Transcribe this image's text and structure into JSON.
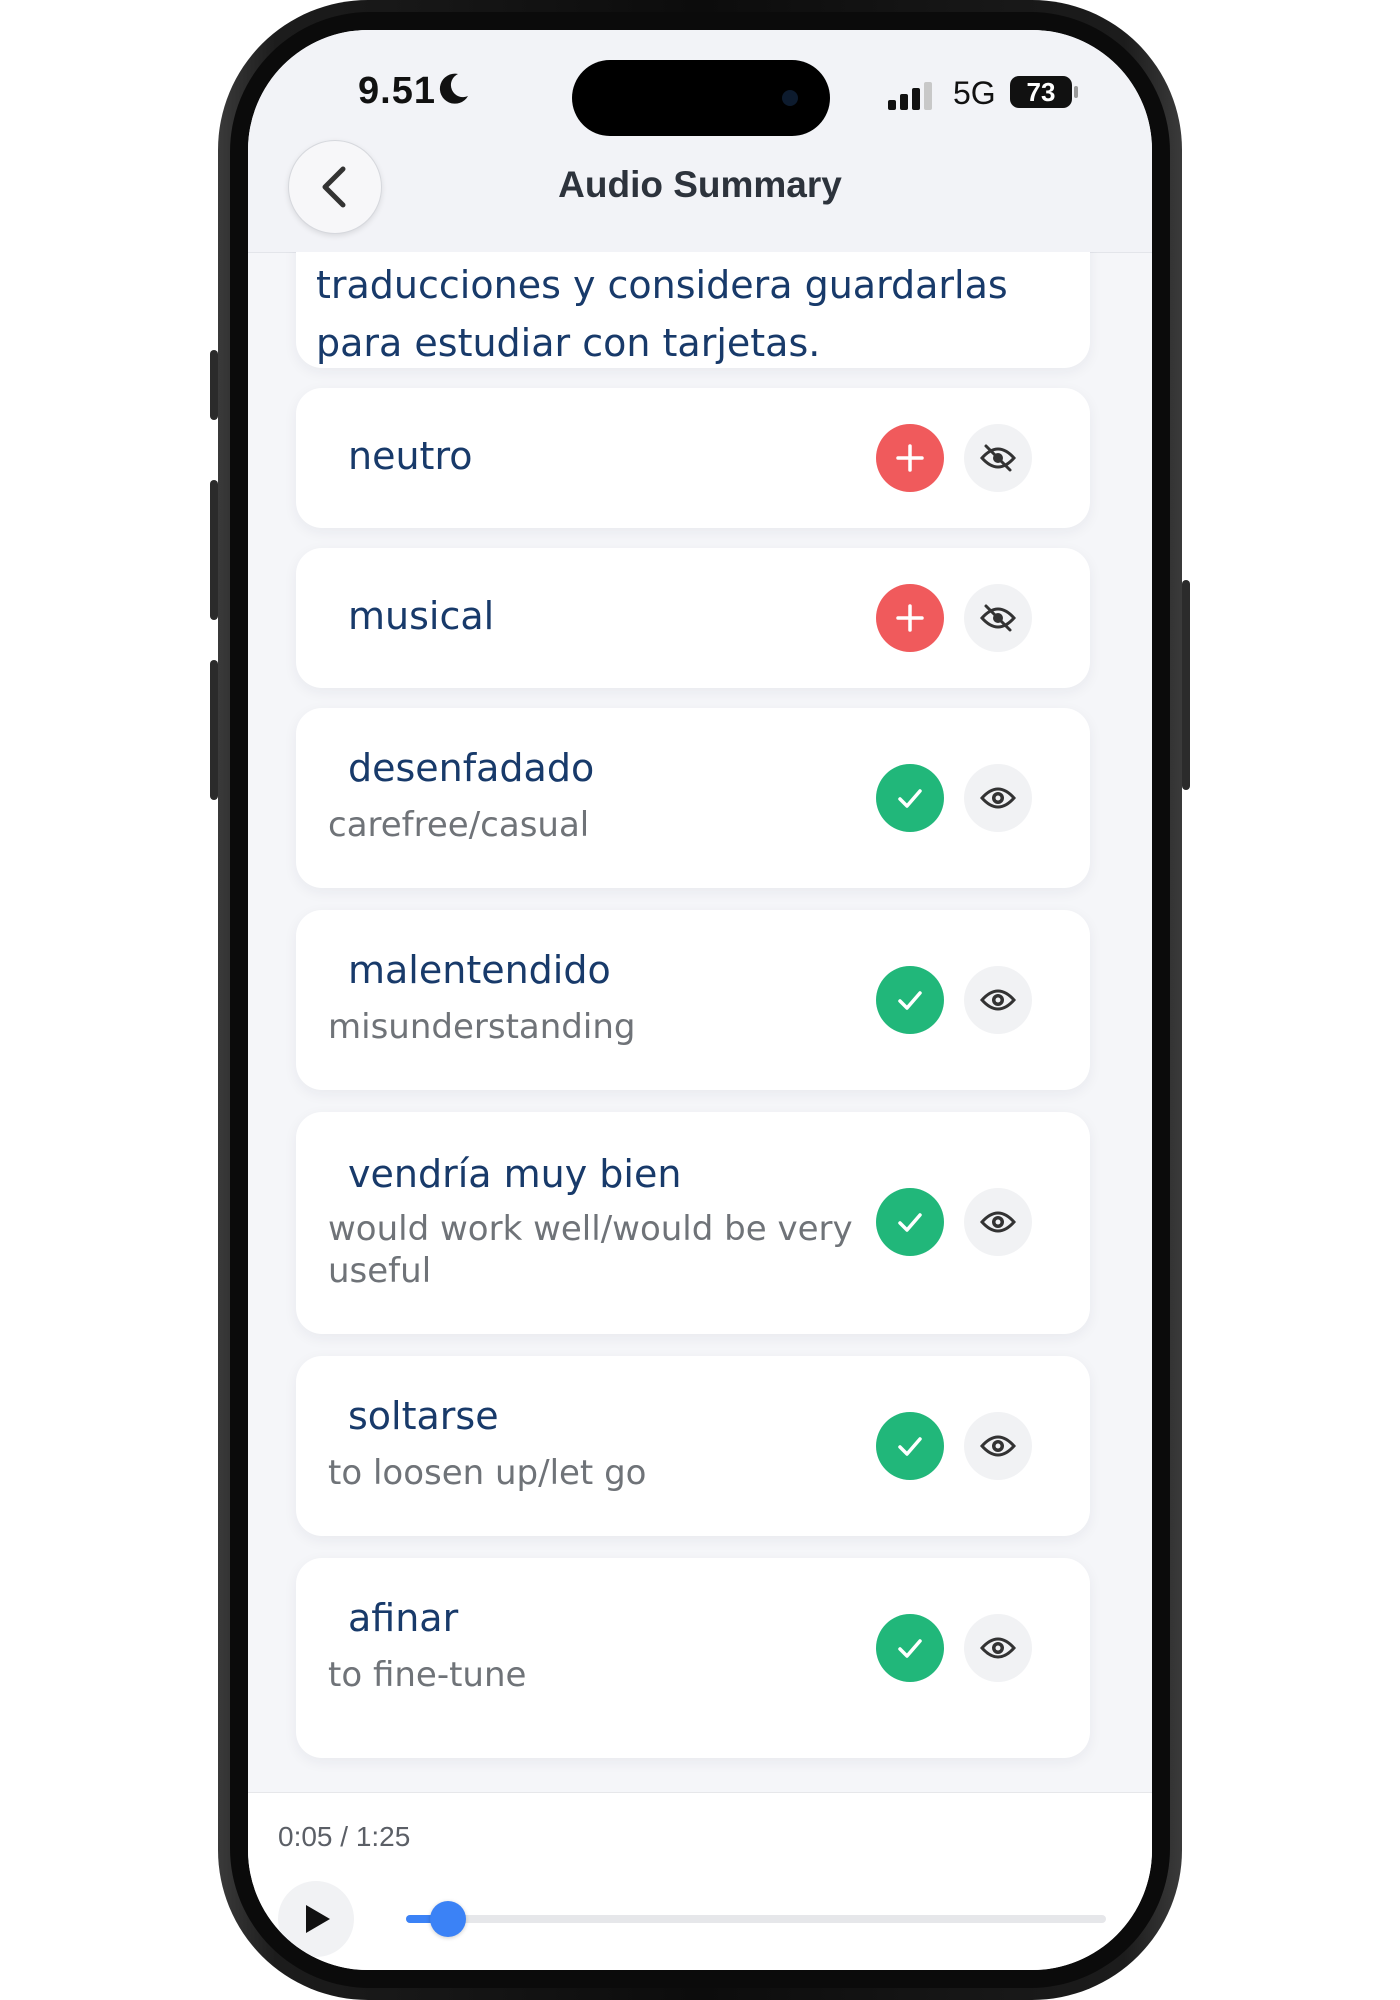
{
  "status_bar": {
    "time": "9.51",
    "network": "5G",
    "battery": "73"
  },
  "header": {
    "title": "Audio Summary"
  },
  "intro": {
    "text": "traducciones y considera guardarlas para estudiar con tarjetas."
  },
  "vocab": [
    {
      "word": "neutro",
      "translation": "",
      "status": "add",
      "visible": false
    },
    {
      "word": "musical",
      "translation": "",
      "status": "add",
      "visible": false
    },
    {
      "word": "desenfadado",
      "translation": "carefree/casual",
      "status": "saved",
      "visible": true
    },
    {
      "word": "malentendido",
      "translation": "misunderstanding",
      "status": "saved",
      "visible": true
    },
    {
      "word": "vendría muy bien",
      "translation": "would work well/would be very useful",
      "status": "saved",
      "visible": true
    },
    {
      "word": "soltarse",
      "translation": "to loosen up/let go",
      "status": "saved",
      "visible": true
    },
    {
      "word": "afinar",
      "translation": "to fine-tune",
      "status": "saved",
      "visible": true
    }
  ],
  "player": {
    "time_label": "0:05 / 1:25",
    "progress": 0.06
  },
  "colors": {
    "add": "#f05a5c",
    "saved": "#21b77a",
    "text": "#183a6a",
    "accent": "#3b82f6"
  },
  "icons": {
    "add": "plus-icon",
    "saved": "check-icon",
    "visible": "eye-icon",
    "hidden": "eye-off-icon",
    "back": "chevron-left-icon",
    "play": "play-icon"
  }
}
